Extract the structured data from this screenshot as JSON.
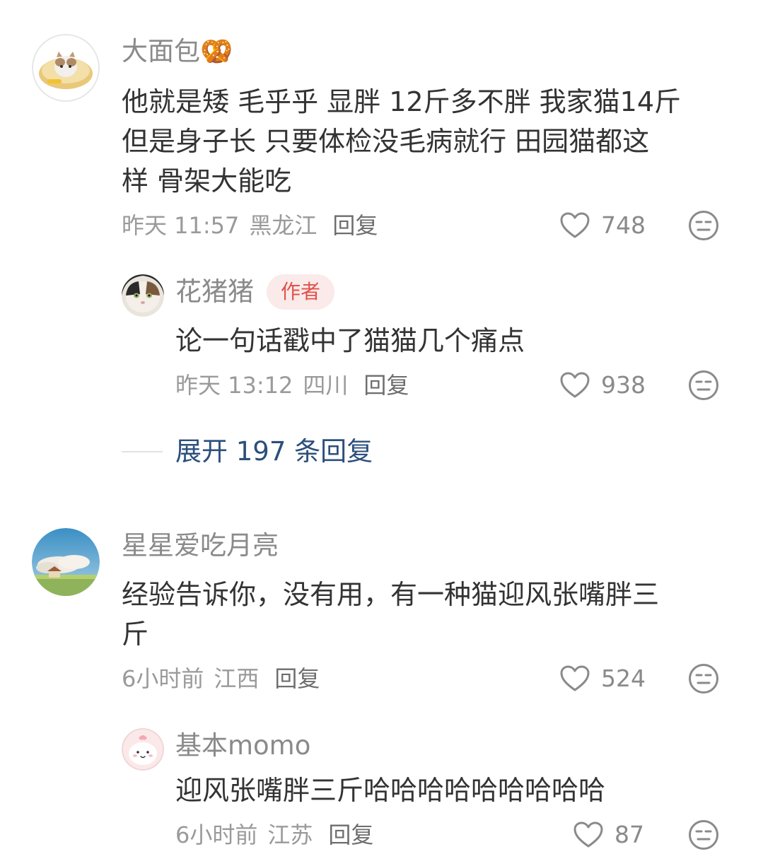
{
  "comments": [
    {
      "author": "大面包🥨",
      "text_lines": [
        "他就是矮 毛乎乎 显胖 12斤多不胖 我家猫14斤",
        "但是身子长 只要体检没毛病就行 田园猫都这",
        "样 骨架大能吃"
      ],
      "time": "昨天 11:57",
      "location": "黑龙江",
      "reply_label": "回复",
      "likes": "748",
      "replies": [
        {
          "author": "花猪猪",
          "badge": "作者",
          "text": "论一句话戳中了猫猫几个痛点",
          "time": "昨天 13:12",
          "location": "四川",
          "reply_label": "回复",
          "likes": "938"
        }
      ],
      "expand_label": "展开 197 条回复"
    },
    {
      "author": "星星爱吃月亮",
      "text_lines": [
        "经验告诉你，没有用，有一种猫迎风张嘴胖三",
        "斤"
      ],
      "time": "6小时前",
      "location": "江西",
      "reply_label": "回复",
      "likes": "524",
      "replies": [
        {
          "author": "基本momo",
          "text": "迎风张嘴胖三斤哈哈哈哈哈哈哈哈哈",
          "time": "6小时前",
          "location": "江苏",
          "reply_label": "回复",
          "likes": "87"
        }
      ]
    }
  ],
  "icons": {
    "like": "heart-outline-icon",
    "dislike": "meh-face-icon"
  },
  "colors": {
    "author_badge_text": "#e0524b",
    "author_badge_bg": "#fbeaea",
    "expand_link": "#2c4f7c"
  }
}
